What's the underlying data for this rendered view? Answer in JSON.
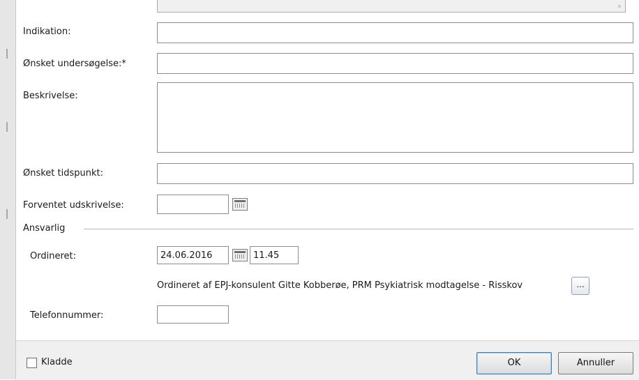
{
  "form": {
    "indikation_label": "Indikation:",
    "indikation_value": "",
    "oensket_undersoegelse_label": "Ønsket undersøgelse:*",
    "oensket_undersoegelse_value": "",
    "beskrivelse_label": "Beskrivelse:",
    "beskrivelse_value": "",
    "oensket_tidspunkt_label": "Ønsket tidspunkt:",
    "oensket_tidspunkt_value": "",
    "forventet_udskrivelse_label": "Forventet udskrivelse:",
    "forventet_udskrivelse_value": ""
  },
  "ansvarlig": {
    "section_label": "Ansvarlig",
    "ordineret_label": "Ordineret:",
    "ordineret_date": "24.06.2016",
    "ordineret_time": "11.45",
    "ordineret_by_text": "Ordineret af EPJ-konsulent Gitte Kobberøe, PRM Psykiatrisk modtagelse - Risskov",
    "more_button_label": "...",
    "telefonnummer_label": "Telefonnummer:",
    "telefonnummer_value": ""
  },
  "footer": {
    "kladde_label": "Kladde",
    "kladde_checked": false,
    "ok_label": "OK",
    "annuller_label": "Annuller"
  },
  "icons": {
    "calendar": "calendar-icon"
  }
}
